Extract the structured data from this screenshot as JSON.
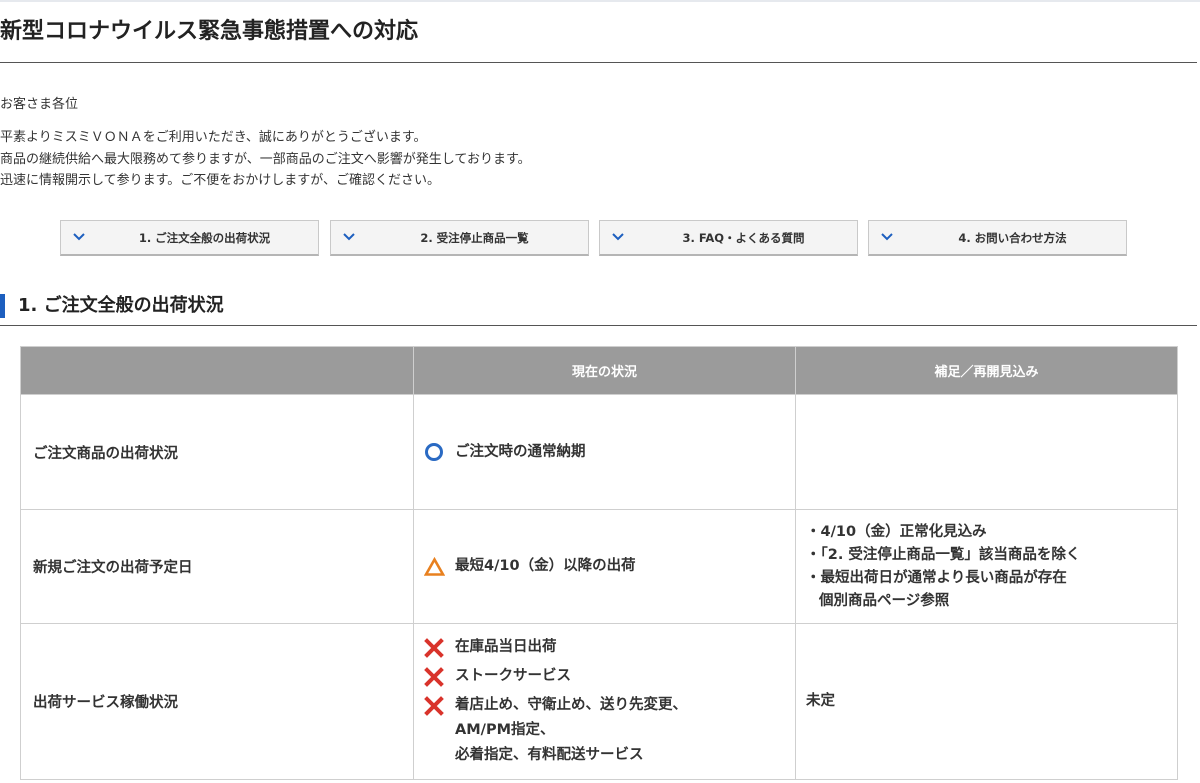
{
  "page": {
    "title": "新型コロナウイルス緊急事態措置への対応"
  },
  "notice": {
    "greeting": "お客さま各位",
    "lines": [
      "平素よりミスミＶＯＮＡをご利用いただき、誠にありがとうございます。",
      "商品の継続供給へ最大限務めて参りますが、一部商品のご注文へ影響が発生しております。",
      "迅速に情報開示して参ります。ご不便をおかけしますが、ご確認ください。"
    ]
  },
  "anchor_nav": [
    {
      "label": "1. ご注文全般の出荷状況",
      "icon": "chevron-down-icon"
    },
    {
      "label": "2. 受注停止商品一覧",
      "icon": "chevron-down-icon"
    },
    {
      "label": "3. FAQ・よくある質問",
      "icon": "chevron-down-icon"
    },
    {
      "label": "4. お問い合わせ方法",
      "icon": "chevron-down-icon"
    }
  ],
  "section1": {
    "heading": "1. ご注文全般の出荷状況",
    "table": {
      "headers": [
        "",
        "現在の状況",
        "補足／再開見込み"
      ],
      "rows": [
        {
          "item": "ご注文商品の出荷状況",
          "status": [
            {
              "mark": "circle-icon",
              "text": "ご注文時の通常納期"
            }
          ],
          "notes": []
        },
        {
          "item": "新規ご注文の出荷予定日",
          "status": [
            {
              "mark": "triangle-icon",
              "text": "最短4/10（金）以降の出荷"
            }
          ],
          "notes": [
            "・4/10（金）正常化見込み",
            "・「2. 受注停止商品一覧」該当商品を除く",
            "・最短出荷日が通常より長い商品が存在",
            "個別商品ページ参照"
          ]
        },
        {
          "item": "出荷サービス稼働状況",
          "status": [
            {
              "mark": "cross-icon",
              "text": "在庫品当日出荷"
            },
            {
              "mark": "cross-icon",
              "text": "ストークサービス"
            },
            {
              "mark": "cross-icon",
              "text": "着店止め、守衛止め、送り先変更、"
            }
          ],
          "status_continuation": [
            "AM/PM指定、",
            "必着指定、有料配送サービス"
          ],
          "notes": [
            "未定"
          ]
        }
      ]
    }
  },
  "colors": {
    "accent": "#1d5fbf",
    "header_bg": "#9b9b9b",
    "circle_mark": "#2a6ac3",
    "triangle_mark": "#e8801f",
    "cross_mark": "#d9332b"
  }
}
